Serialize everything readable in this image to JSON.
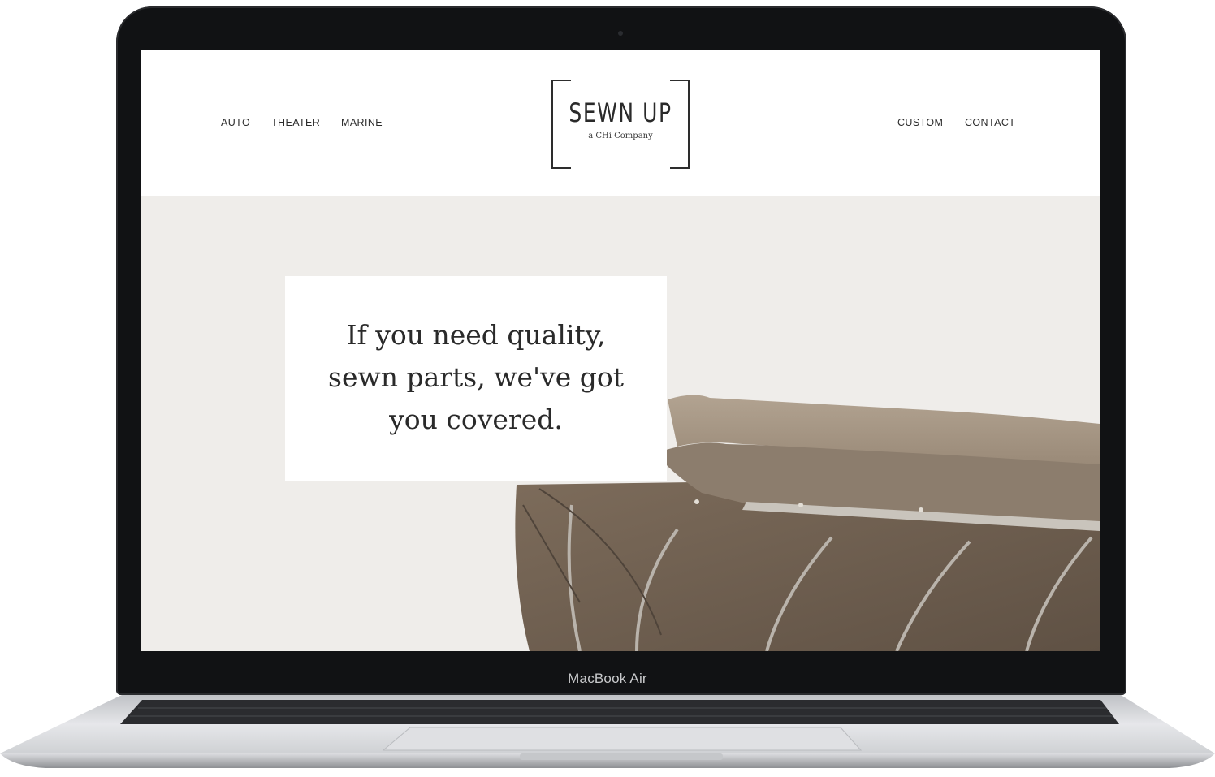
{
  "device": {
    "label": "MacBook Air"
  },
  "site": {
    "nav_left": [
      "AUTO",
      "THEATER",
      "MARINE"
    ],
    "nav_right": [
      "CUSTOM",
      "CONTACT"
    ],
    "logo": {
      "title": "SEWN UP",
      "subtitle": "a CHi Company"
    },
    "hero": {
      "headline_lines": [
        "If you need quality,",
        "sewn parts, we've got",
        "you covered."
      ]
    }
  },
  "colors": {
    "hero_background": "#efedea",
    "canopy_fabric": "#a39381",
    "bezel": "#111214",
    "aluminum": "#d8d9dc"
  }
}
